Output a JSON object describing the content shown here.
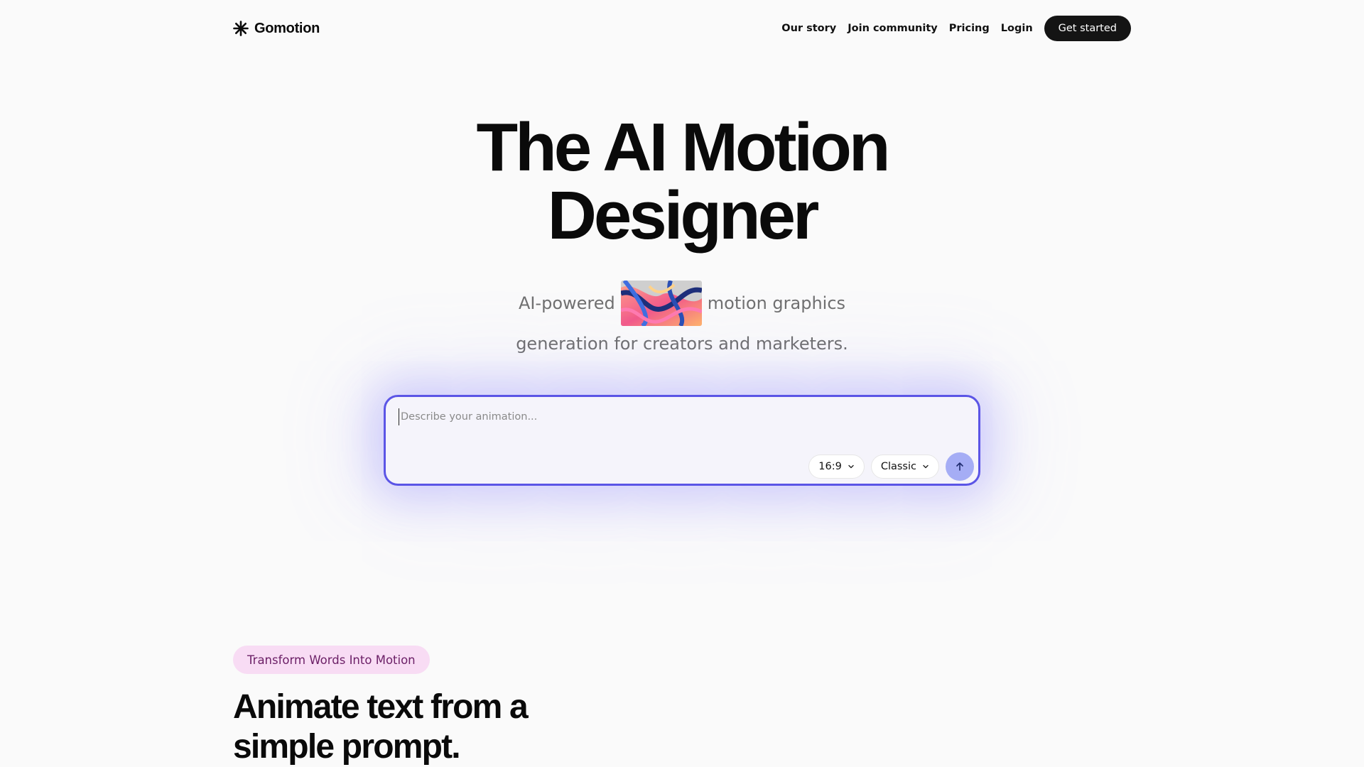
{
  "nav": {
    "brand_name": "Gomotion",
    "brand_icon": "asterisk-logo-icon",
    "links": [
      {
        "label": "Our story"
      },
      {
        "label": "Join community"
      },
      {
        "label": "Pricing"
      },
      {
        "label": "Login"
      }
    ],
    "cta_label": "Get started"
  },
  "hero": {
    "title_line1": "The AI Motion",
    "title_line2": "Designer",
    "subtitle_before": "AI-powered",
    "subtitle_after": "motion graphics",
    "subtitle_line2": "generation for creators and marketers."
  },
  "prompt": {
    "placeholder": "Describe your animation...",
    "value": "",
    "aspect_ratio": "16:9",
    "style": "Classic",
    "send_icon": "arrow-up-icon",
    "accent_color": "#5b55e6"
  },
  "section": {
    "badge": "Transform Words Into Motion",
    "title_line1": "Animate text from a",
    "title_line2": "simple prompt."
  }
}
